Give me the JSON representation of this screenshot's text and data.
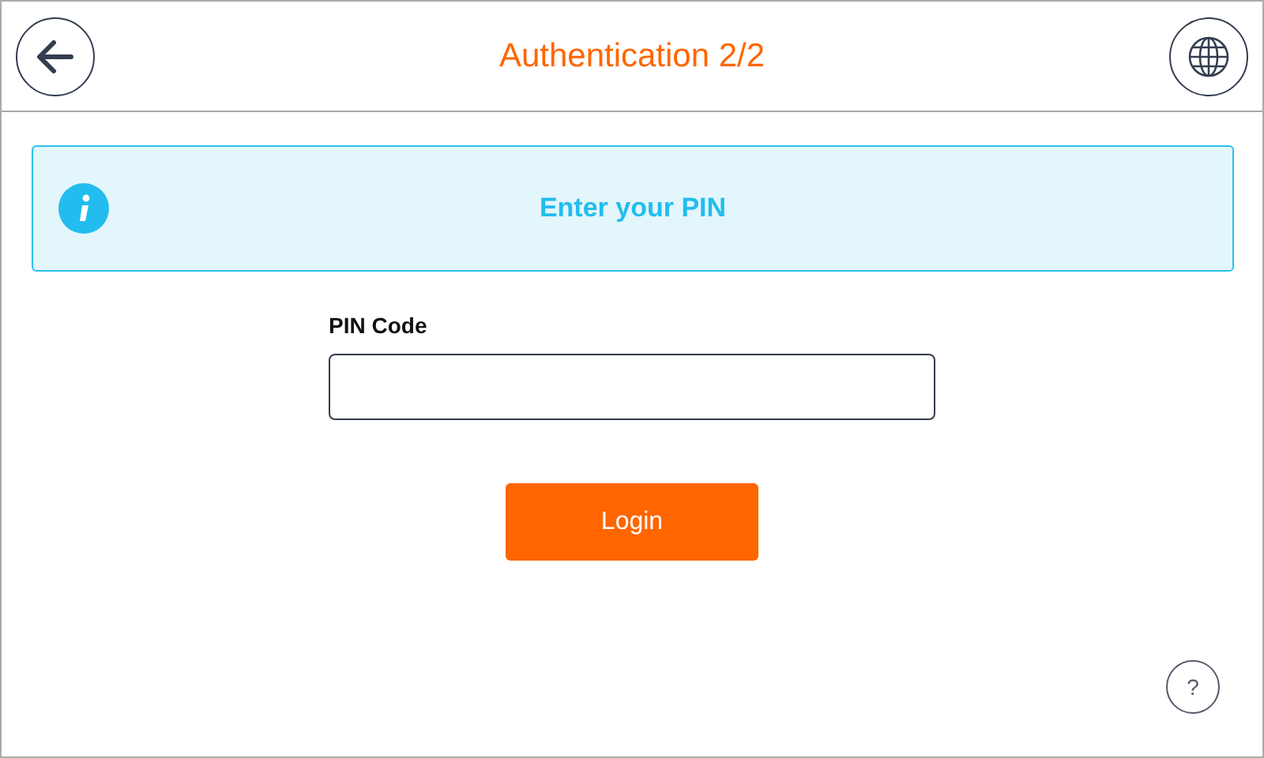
{
  "header": {
    "title": "Authentication 2/2"
  },
  "info": {
    "message": "Enter your PIN"
  },
  "form": {
    "label": "PIN Code"
  },
  "login_button": "Login",
  "help_button": "?"
}
